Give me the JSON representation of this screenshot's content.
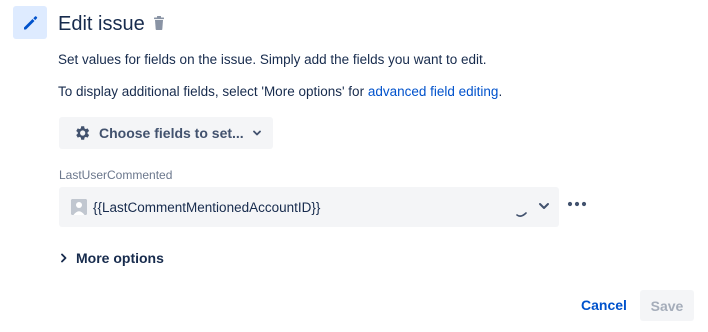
{
  "header": {
    "title": "Edit issue",
    "edit_icon": "pencil-icon",
    "delete_icon": "trash-icon"
  },
  "description": {
    "line1": "Set values for fields on the issue. Simply add the fields you want to edit.",
    "line2_prefix": "To display additional fields, select 'More options' for ",
    "line2_link": "advanced field editing",
    "line2_suffix": "."
  },
  "choose_fields": {
    "label": "Choose fields to set...",
    "icon": "gear-icon"
  },
  "field": {
    "label": "LastUserCommented",
    "value": "{{LastCommentMentionedAccountID}}",
    "icon": "user-avatar-icon"
  },
  "more_options": {
    "label": "More options"
  },
  "actions": {
    "cancel": "Cancel",
    "save": "Save"
  },
  "colors": {
    "primary_blue": "#0052cc",
    "icon_bg": "#deebff",
    "field_bg": "#f4f5f7",
    "text": "#172b4d",
    "muted": "#6b778c",
    "disabled": "#a5adba"
  }
}
